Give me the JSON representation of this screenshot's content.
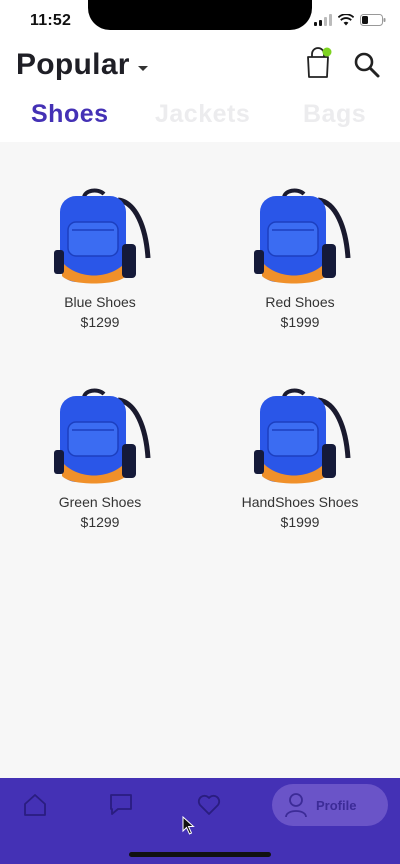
{
  "status": {
    "time": "11:52"
  },
  "header": {
    "title": "Popular"
  },
  "tabs": [
    {
      "label": "Shoes"
    },
    {
      "label": "Jackets"
    },
    {
      "label": "Bags"
    }
  ],
  "products": [
    {
      "name": "Blue Shoes",
      "price": "$1299"
    },
    {
      "name": "Red Shoes",
      "price": "$1999"
    },
    {
      "name": "Green Shoes",
      "price": "$1299"
    },
    {
      "name": "HandShoes Shoes",
      "price": "$1999"
    }
  ],
  "bottom_nav": {
    "profile_label": "Profile"
  },
  "icons": {
    "cart": "shopping-bag-icon",
    "search": "search-icon",
    "home": "home-icon",
    "chat": "chat-icon",
    "favorites": "heart-icon",
    "profile": "user-icon"
  },
  "colors": {
    "accent": "#4431b5",
    "profile_pill": "#6a54c8",
    "cart_badge": "#7ed321",
    "inactive_tab": "#ececee",
    "content_bg": "#f7f7f7"
  }
}
